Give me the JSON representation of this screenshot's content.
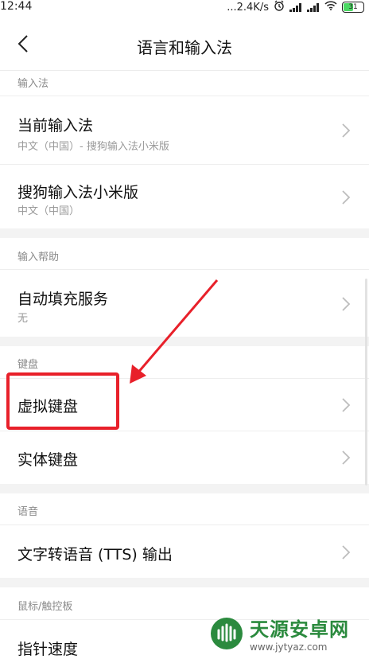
{
  "status_bar": {
    "time": "12:44",
    "network_speed": "...2.4K/s",
    "battery": "31"
  },
  "header": {
    "title": "语言和输入法"
  },
  "sections": {
    "input_method": {
      "label": "输入法",
      "items": [
        {
          "title": "当前输入法",
          "subtitle": "中文（中国）- 搜狗输入法小米版"
        },
        {
          "title": "搜狗输入法小米版",
          "subtitle": "中文（中国）"
        }
      ]
    },
    "input_help": {
      "label": "输入帮助",
      "items": [
        {
          "title": "自动填充服务",
          "subtitle": "无"
        }
      ]
    },
    "keyboard": {
      "label": "键盘",
      "items": [
        {
          "title": "虚拟键盘"
        },
        {
          "title": "实体键盘"
        }
      ]
    },
    "speech": {
      "label": "语音",
      "items": [
        {
          "title": "文字转语音 (TTS) 输出"
        }
      ]
    },
    "mouse": {
      "label": "鼠标/触控板",
      "items": [
        {
          "title": "指针速度"
        }
      ]
    }
  },
  "annotation": {
    "highlight_color": "#e8202a"
  },
  "watermark": {
    "name": "天源安卓网",
    "url": "www.jytyaz.com"
  }
}
